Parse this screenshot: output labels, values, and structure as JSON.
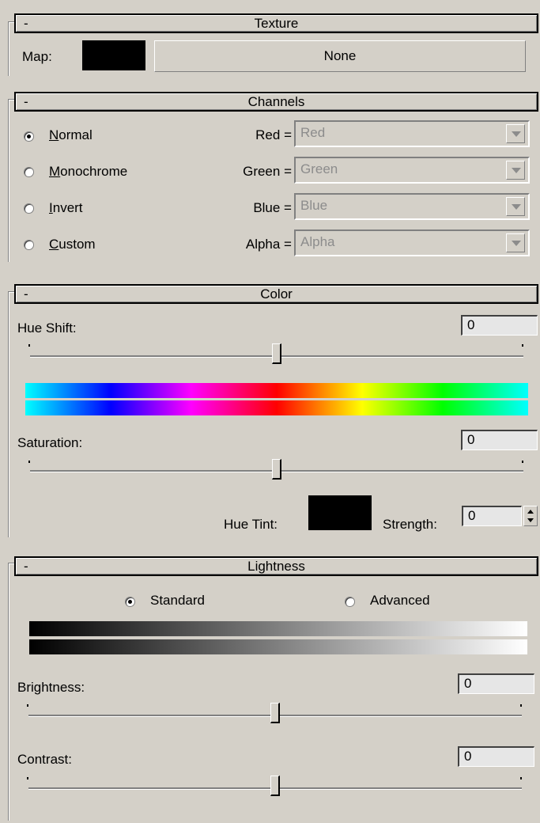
{
  "texture": {
    "header_minus": "-",
    "title": "Texture",
    "map_label": "Map:",
    "map_button": "None",
    "map_color": "#000000"
  },
  "channels": {
    "header_minus": "-",
    "title": "Channels",
    "modes": [
      {
        "label": "Normal",
        "mnemonic": "N",
        "rest": "ormal",
        "checked": true
      },
      {
        "label": "Monochrome",
        "mnemonic": "M",
        "rest": "onochrome",
        "checked": false
      },
      {
        "label": "Invert",
        "mnemonic": "I",
        "rest": "nvert",
        "checked": false
      },
      {
        "label": "Custom",
        "mnemonic": "C",
        "rest": "ustom",
        "checked": false
      }
    ],
    "mappings": [
      {
        "label": "Red =",
        "value": "Red"
      },
      {
        "label": "Green =",
        "value": "Green"
      },
      {
        "label": "Blue =",
        "value": "Blue"
      },
      {
        "label": "Alpha =",
        "value": "Alpha"
      }
    ]
  },
  "color": {
    "header_minus": "-",
    "title": "Color",
    "hue_shift_label": "Hue Shift:",
    "hue_shift_value": "0",
    "saturation_label": "Saturation:",
    "saturation_value": "0",
    "hue_tint_label": "Hue Tint:",
    "hue_tint_color": "#000000",
    "strength_label": "Strength:",
    "strength_value": "0"
  },
  "lightness": {
    "header_minus": "-",
    "title": "Lightness",
    "standard_label": "Standard",
    "advanced_label": "Advanced",
    "standard_checked": true,
    "brightness_label": "Brightness:",
    "brightness_value": "0",
    "contrast_label": "Contrast:",
    "contrast_value": "0"
  }
}
